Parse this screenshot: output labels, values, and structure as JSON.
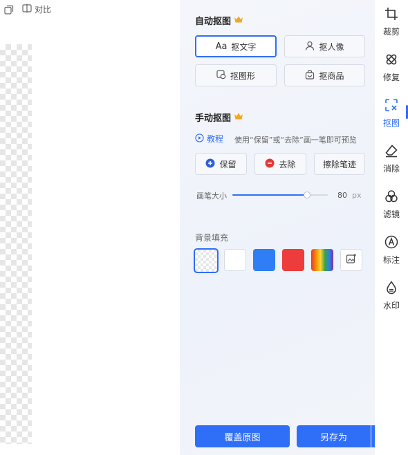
{
  "topbar": {
    "copy_icon": "copy-icon",
    "compare_icon": "compare-icon",
    "compare_label": "对比"
  },
  "auto_cutout": {
    "title": "自动抠图",
    "badge_icon": "crown-icon",
    "buttons": [
      {
        "label": "抠文字",
        "icon": "text-aa-icon",
        "active": true
      },
      {
        "label": "抠人像",
        "icon": "person-icon",
        "active": false
      },
      {
        "label": "抠图形",
        "icon": "shape-icon",
        "active": false
      },
      {
        "label": "抠商品",
        "icon": "shopping-bag-icon",
        "active": false
      }
    ]
  },
  "manual_cutout": {
    "title": "手动抠图",
    "badge_icon": "crown-icon",
    "tutorial_label": "教程",
    "hint": "使用“保留”或“去除”画一笔即可预览",
    "buttons": [
      {
        "label": "保留",
        "icon": "plus-circle-icon"
      },
      {
        "label": "去除",
        "icon": "minus-circle-icon"
      },
      {
        "label": "擦除笔迹",
        "icon": ""
      }
    ],
    "brush": {
      "label": "画笔大小",
      "value": "80",
      "unit": "px",
      "level_percent": 78
    }
  },
  "background": {
    "title": "背景填充",
    "swatches": [
      {
        "name": "transparent",
        "selected": true
      },
      {
        "name": "white",
        "color": "#ffffff"
      },
      {
        "name": "blue",
        "color": "#2f7ef6"
      },
      {
        "name": "red",
        "color": "#ee3b3b"
      },
      {
        "name": "rainbow"
      },
      {
        "name": "custom-image",
        "icon": "image-upload-icon"
      }
    ]
  },
  "footer": {
    "cover_label": "覆盖原图",
    "save_as_label": "另存为",
    "dropdown_icon": "caret-up-icon"
  },
  "toolbar": {
    "items": [
      {
        "label": "裁剪",
        "icon": "crop-icon"
      },
      {
        "label": "修复",
        "icon": "bandage-icon"
      },
      {
        "label": "抠图",
        "icon": "cutout-icon",
        "active": true
      },
      {
        "label": "消除",
        "icon": "eraser-icon"
      },
      {
        "label": "滤镜",
        "icon": "filter-icon"
      },
      {
        "label": "标注",
        "icon": "annotate-icon"
      },
      {
        "label": "水印",
        "icon": "watermark-icon"
      }
    ]
  },
  "colors": {
    "accent": "#2f6ef7",
    "crown": "#f5a623"
  }
}
